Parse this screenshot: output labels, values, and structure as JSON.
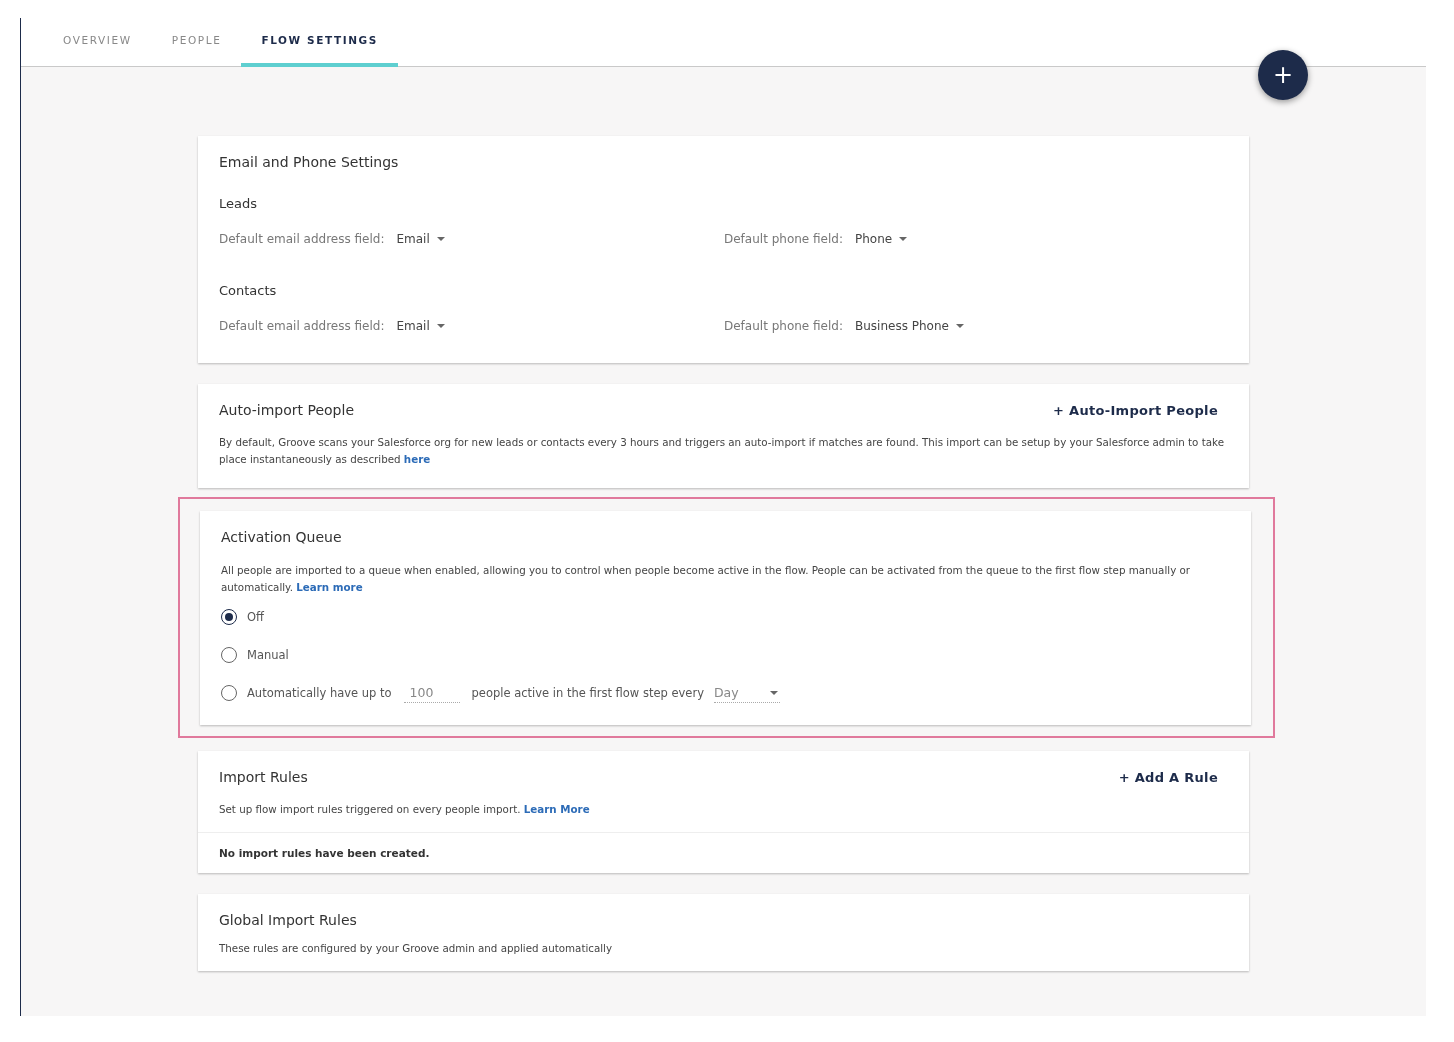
{
  "tabs": [
    {
      "label": "OVERVIEW",
      "selected": false
    },
    {
      "label": "PEOPLE",
      "selected": false
    },
    {
      "label": "FLOW SETTINGS",
      "selected": true
    }
  ],
  "fab": {
    "label": "+"
  },
  "email_phone": {
    "title": "Email and Phone Settings",
    "groups": [
      {
        "title": "Leads",
        "email_label": "Default email address field:",
        "email_value": "Email",
        "phone_label": "Default phone field:",
        "phone_value": "Phone"
      },
      {
        "title": "Contacts",
        "email_label": "Default email address field:",
        "email_value": "Email",
        "phone_label": "Default phone field:",
        "phone_value": "Business Phone"
      }
    ]
  },
  "auto_import": {
    "title": "Auto-import People",
    "action": "+  Auto-Import People",
    "text": "By default, Groove scans your Salesforce org for new leads or contacts every 3 hours and triggers an auto-import if matches are found. This import can be setup by your Salesforce admin to take place instantaneously as described",
    "link": "here"
  },
  "activation": {
    "title": "Activation Queue",
    "highlighted": true,
    "text": "All people are imported to a queue when enabled, allowing you to control when people become active in the flow. People can be activated from the queue to the first flow step manually or automatically.",
    "link": "Learn more",
    "options": [
      {
        "kind": "plain",
        "label": "Off",
        "selected": true
      },
      {
        "kind": "plain",
        "label": "Manual",
        "selected": false
      },
      {
        "kind": "auto",
        "label": "Automatically have up to",
        "count": "100",
        "middle": "people active in the first flow step every",
        "period": "Day",
        "selected": false
      }
    ]
  },
  "import_rules": {
    "title": "Import Rules",
    "action": "+ Add A Rule",
    "text": "Set up flow import rules triggered on every people import.",
    "link": "Learn More",
    "empty": "No import rules have been created."
  },
  "global_rules": {
    "title": "Global Import Rules",
    "text": "These rules are configured by your Groove admin and applied automatically"
  }
}
